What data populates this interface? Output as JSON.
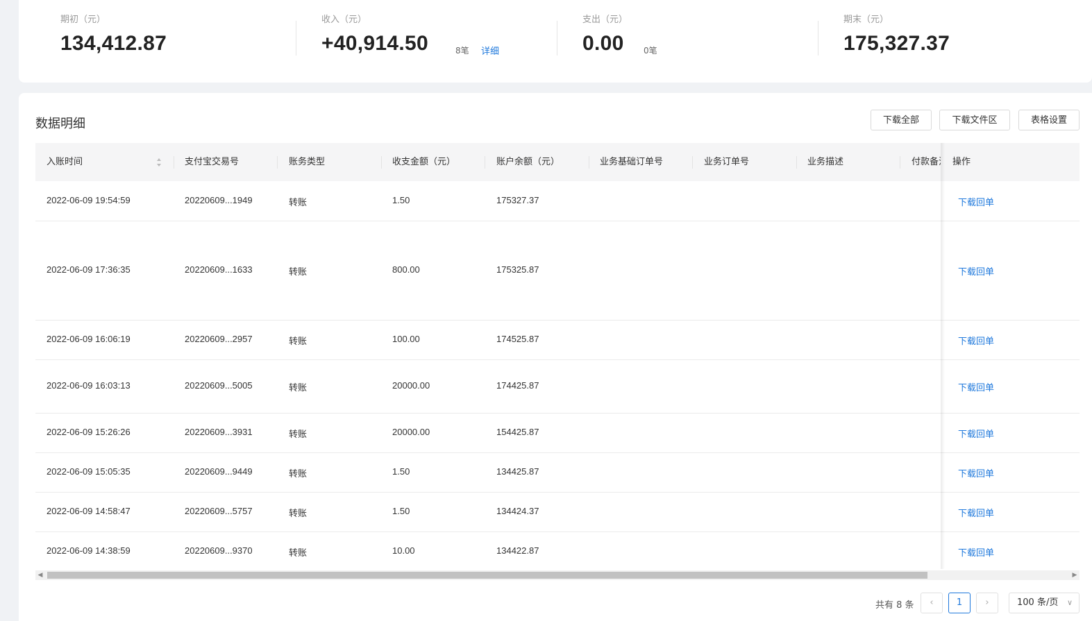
{
  "summary": {
    "opening": {
      "label": "期初（元）",
      "value": "134,412.87"
    },
    "income": {
      "label": "收入（元）",
      "value": "+40,914.50",
      "count": "8笔",
      "detail": "详细"
    },
    "expense": {
      "label": "支出（元）",
      "value": "0.00",
      "count": "0笔"
    },
    "closing": {
      "label": "期末（元）",
      "value": "175,327.37"
    }
  },
  "section": {
    "title": "数据明细",
    "buttons": [
      "下载全部",
      "下载文件区",
      "表格设置"
    ]
  },
  "table": {
    "columns": [
      "入账时间",
      "支付宝交易号",
      "账务类型",
      "收支金额（元）",
      "账户余额（元）",
      "业务基础订单号",
      "业务订单号",
      "业务描述",
      "付款备注",
      "操作"
    ],
    "rows": [
      {
        "time": "2022-06-09 19:54:59",
        "txn": "20220609...1949",
        "type": "转账",
        "amount": "1.50",
        "balance": "175327.37",
        "action": "下载回单"
      },
      {
        "time": "2022-06-09 17:36:35",
        "txn": "20220609...1633",
        "type": "转账",
        "amount": "800.00",
        "balance": "175325.87",
        "action": "下载回单"
      },
      {
        "time": "2022-06-09 16:06:19",
        "txn": "20220609...2957",
        "type": "转账",
        "amount": "100.00",
        "balance": "174525.87",
        "action": "下载回单"
      },
      {
        "time": "2022-06-09 16:03:13",
        "txn": "20220609...5005",
        "type": "转账",
        "amount": "20000.00",
        "balance": "174425.87",
        "action": "下载回单"
      },
      {
        "time": "2022-06-09 15:26:26",
        "txn": "20220609...3931",
        "type": "转账",
        "amount": "20000.00",
        "balance": "154425.87",
        "action": "下载回单"
      },
      {
        "time": "2022-06-09 15:05:35",
        "txn": "20220609...9449",
        "type": "转账",
        "amount": "1.50",
        "balance": "134425.87",
        "action": "下载回单"
      },
      {
        "time": "2022-06-09 14:58:47",
        "txn": "20220609...5757",
        "type": "转账",
        "amount": "1.50",
        "balance": "134424.37",
        "action": "下载回单"
      },
      {
        "time": "2022-06-09 14:38:59",
        "txn": "20220609...9370",
        "type": "转账",
        "amount": "10.00",
        "balance": "134422.87",
        "action": "下载回单"
      }
    ]
  },
  "pagination": {
    "total": "共有 8 条",
    "current_page": "1",
    "page_size": "100 条/页",
    "prev_icon": "chevron-left-icon",
    "next_icon": "chevron-right-icon"
  },
  "colors": {
    "link": "#1e78dc",
    "header_bg": "#f5f5f6",
    "page_bg": "#f0f2f5"
  }
}
